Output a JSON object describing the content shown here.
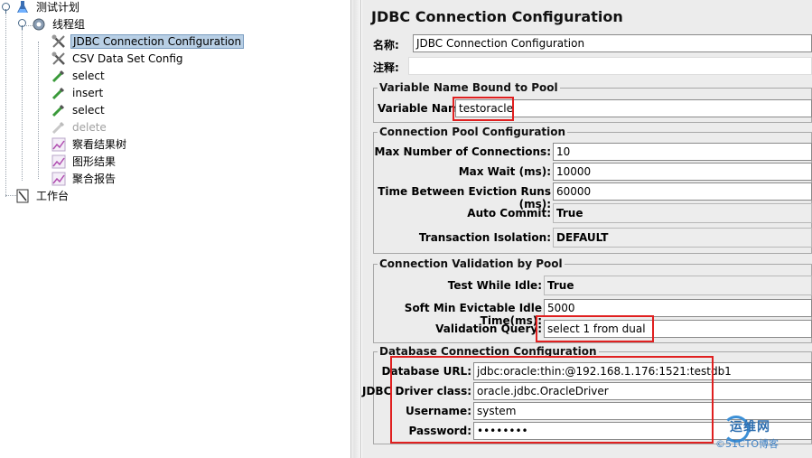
{
  "tree": {
    "items": [
      {
        "label": "测试计划",
        "icon": "test-plan-icon"
      },
      {
        "label": "线程组",
        "icon": "gear-icon"
      },
      {
        "label": "JDBC Connection Configuration",
        "icon": "wrench-screwdriver-icon"
      },
      {
        "label": "CSV Data Set Config",
        "icon": "wrench-screwdriver-icon"
      },
      {
        "label": "select",
        "icon": "pipette-icon"
      },
      {
        "label": "insert",
        "icon": "pipette-icon"
      },
      {
        "label": "select",
        "icon": "pipette-icon"
      },
      {
        "label": "delete",
        "icon": "pipette-icon"
      },
      {
        "label": "察看结果树",
        "icon": "chart-icon"
      },
      {
        "label": "图形结果",
        "icon": "chart-icon"
      },
      {
        "label": "聚合报告",
        "icon": "chart-icon"
      },
      {
        "label": "工作台",
        "icon": "workbench-icon"
      }
    ]
  },
  "panel": {
    "title": "JDBC Connection Configuration",
    "name_label": "名称:",
    "name_value": "JDBC Connection Configuration",
    "comment_label": "注释:",
    "comment_value": "",
    "var_group": {
      "legend": "Variable Name Bound to Pool",
      "label": "Variable Name",
      "value": "testoracle"
    },
    "pool_group": {
      "legend": "Connection Pool Configuration",
      "max_conn_label": "Max Number of Connections:",
      "max_conn_value": "10",
      "max_wait_label": "Max Wait (ms):",
      "max_wait_value": "10000",
      "eviction_label": "Time Between Eviction Runs (ms):",
      "eviction_value": "60000",
      "auto_commit_label": "Auto Commit:",
      "auto_commit_value": "True",
      "isolation_label": "Transaction Isolation:",
      "isolation_value": "DEFAULT"
    },
    "validation_group": {
      "legend": "Connection Validation by Pool",
      "idle_label": "Test While Idle:",
      "idle_value": "True",
      "soft_min_label": "Soft Min Evictable Idle Time(ms):",
      "soft_min_value": "5000",
      "query_label": "Validation Query:",
      "query_value": "select 1 from dual"
    },
    "db_group": {
      "legend": "Database Connection Configuration",
      "url_label": "Database URL:",
      "url_value": "jdbc:oracle:thin:@192.168.1.176:1521:testdb1",
      "driver_label": "JDBC Driver class:",
      "driver_value": "oracle.jdbc.OracleDriver",
      "user_label": "Username:",
      "user_value": "system",
      "password_label": "Password:",
      "password_value": "••••••••"
    }
  },
  "watermark": {
    "line1": "运维网",
    "line2": "©51CTO博客"
  },
  "colors": {
    "highlight": "#e02020",
    "selection": "#b8cfe5",
    "panel_bg": "#ececec"
  }
}
